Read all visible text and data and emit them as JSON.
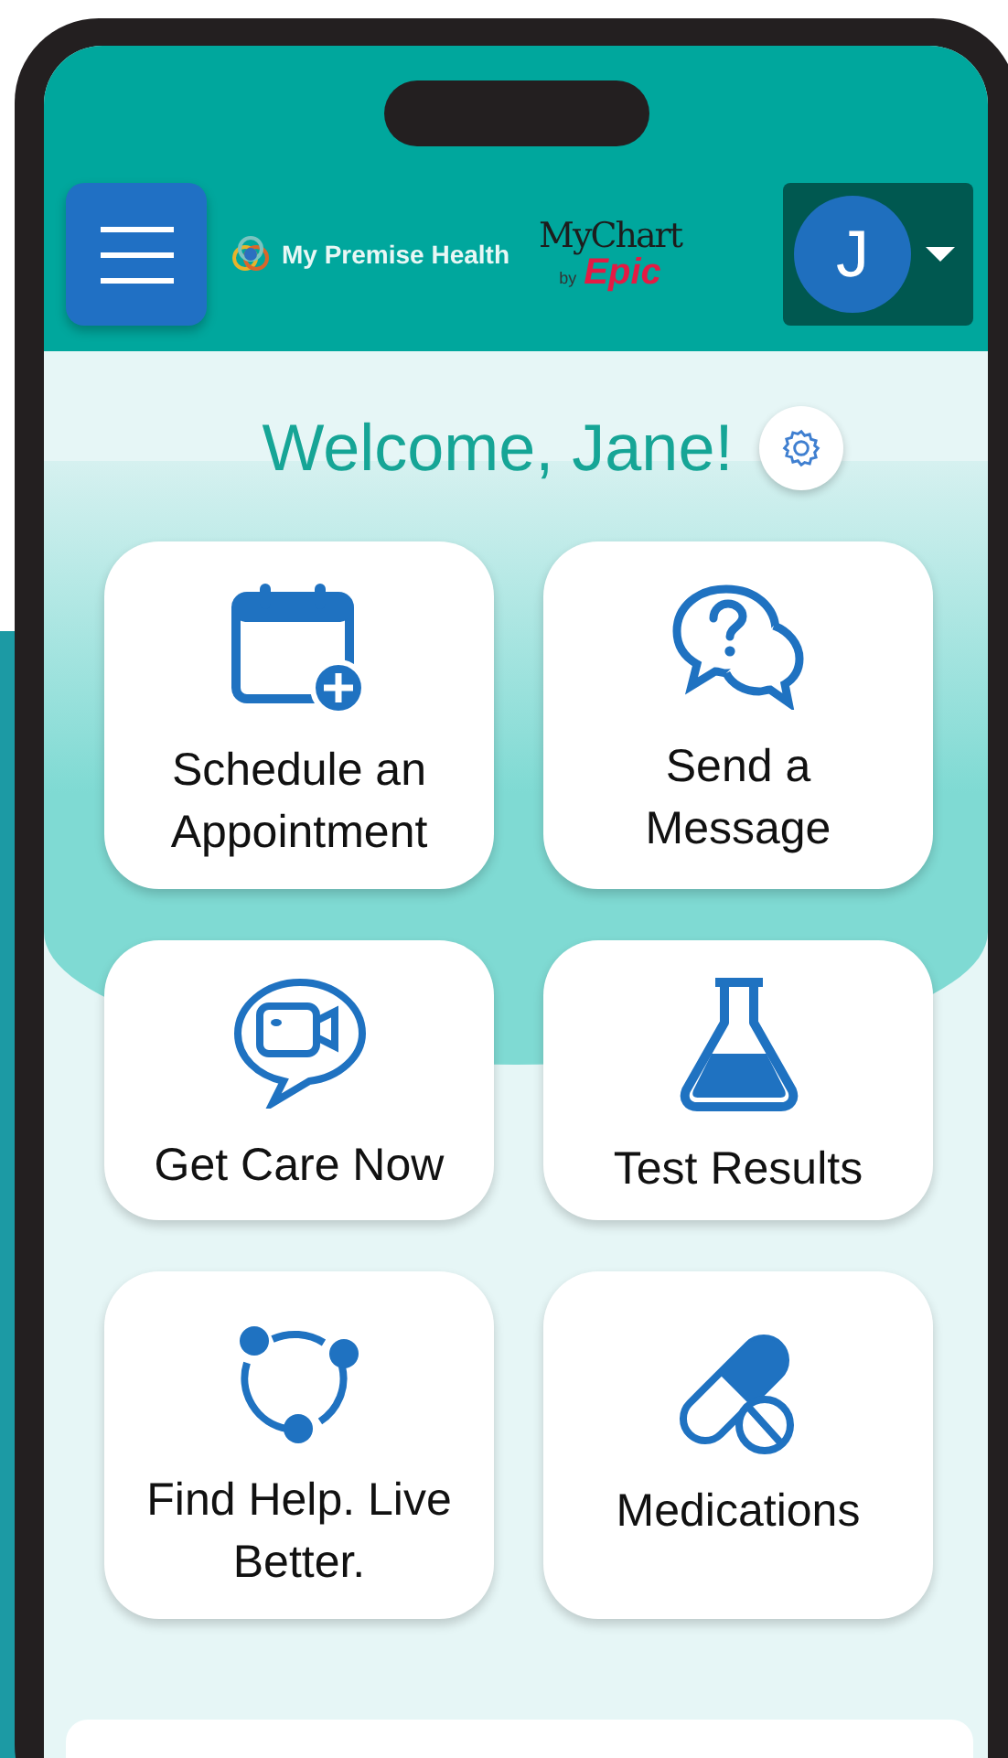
{
  "header": {
    "brand": "My Premise Health",
    "partner_logo": {
      "name": "MyChart",
      "by": "by",
      "brand": "Epic"
    },
    "avatar": {
      "initial": "J"
    }
  },
  "welcome": "Welcome, Jane!",
  "tiles": [
    {
      "kind": "calendar",
      "label": "Schedule an Appointment"
    },
    {
      "kind": "message",
      "label": "Send a Message"
    },
    {
      "kind": "video",
      "label": "Get Care Now"
    },
    {
      "kind": "flask",
      "label": "Test Results"
    },
    {
      "kind": "network",
      "label": "Find Help. Live Better."
    },
    {
      "kind": "pills",
      "label": "Medications"
    }
  ]
}
